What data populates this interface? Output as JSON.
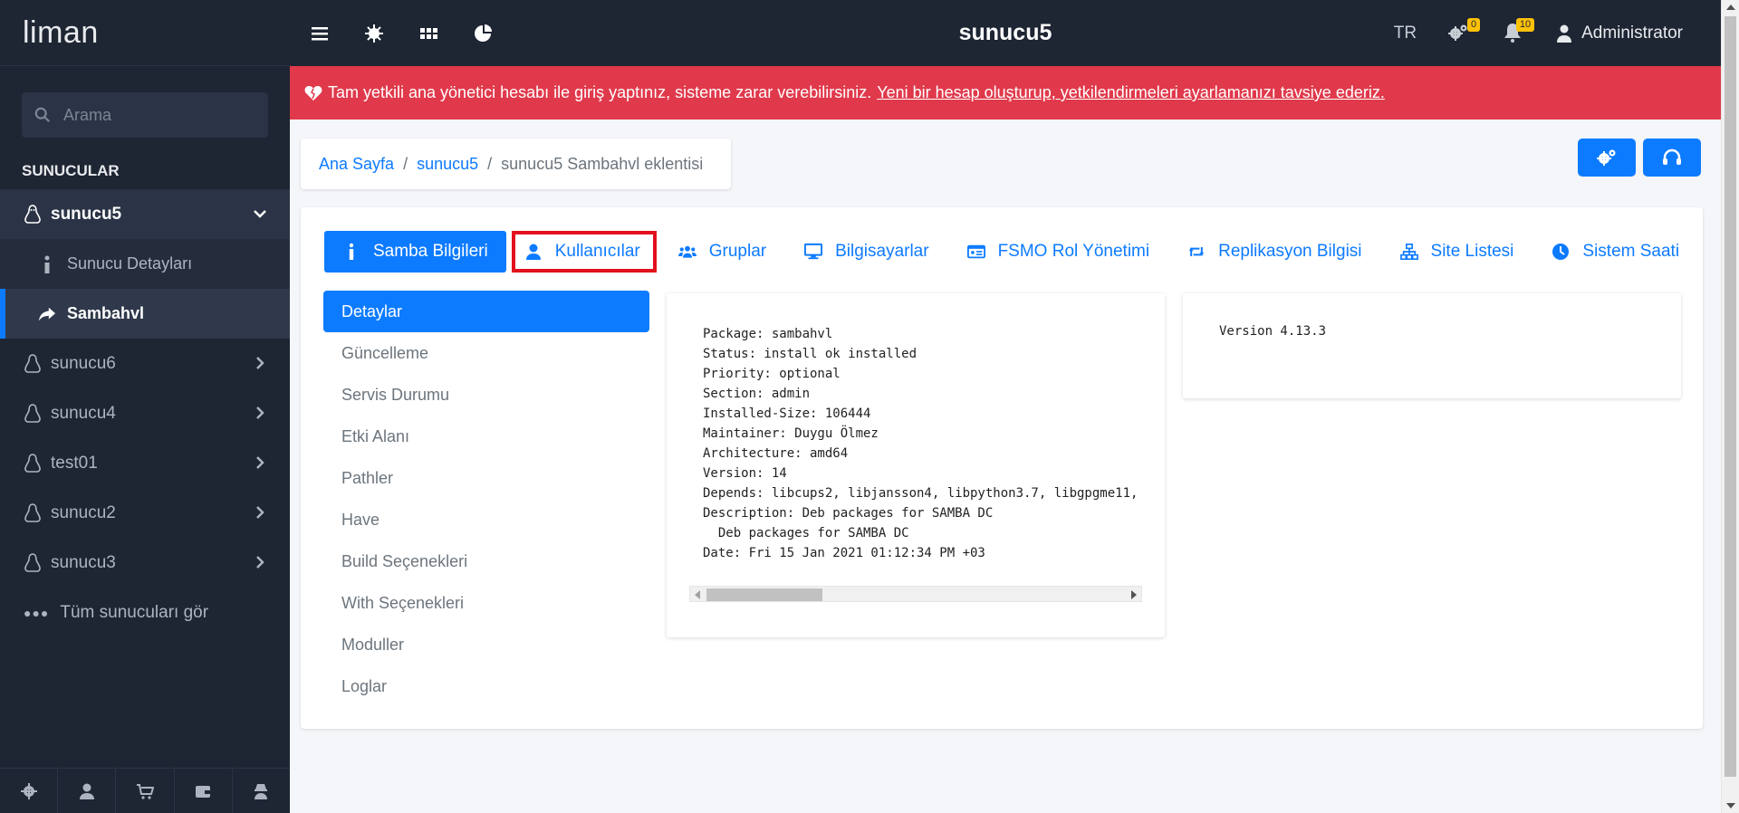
{
  "app": {
    "logo": "liman",
    "page_title": "sunucu5"
  },
  "sidebar": {
    "search_placeholder": "Arama",
    "section_title": "SUNUCULAR",
    "servers": [
      {
        "label": "sunucu5",
        "active": true,
        "subitems": [
          {
            "label": "Sunucu Detayları"
          },
          {
            "label": "Sambahvl",
            "current": true
          }
        ]
      },
      {
        "label": "sunucu6"
      },
      {
        "label": "sunucu4"
      },
      {
        "label": "test01"
      },
      {
        "label": "sunucu2"
      },
      {
        "label": "sunucu3"
      }
    ],
    "all_servers": "Tüm sunucuları gör",
    "footer_icons": [
      "settings-icon",
      "user-icon",
      "cart-icon",
      "wallet-icon",
      "spy-icon"
    ]
  },
  "topbar": {
    "lang": "TR",
    "settings_badge": "0",
    "notifications_badge": "10",
    "user": "Administrator"
  },
  "alert": {
    "text": "Tam yetkili ana yönetici hesabı ile giriş yaptınız, sisteme zarar verebilirsiniz.",
    "link": "Yeni bir hesap oluşturup, yetkilendirmeleri ayarlamanızı tavsiye ederiz."
  },
  "breadcrumb": {
    "home": "Ana Sayfa",
    "server": "sunucu5",
    "current": "sunucu5 Sambahvl eklentisi"
  },
  "tabs": [
    {
      "label": "Samba Bilgileri",
      "icon": "info-icon",
      "active": true
    },
    {
      "label": "Kullanıcılar",
      "icon": "user-icon",
      "highlight": true
    },
    {
      "label": "Gruplar",
      "icon": "users-icon"
    },
    {
      "label": "Bilgisayarlar",
      "icon": "desktop-icon"
    },
    {
      "label": "FSMO Rol Yönetimi",
      "icon": "id-card-icon"
    },
    {
      "label": "Replikasyon Bilgisi",
      "icon": "retweet-icon"
    },
    {
      "label": "Site Listesi",
      "icon": "sitemap-icon"
    },
    {
      "label": "Sistem Saati",
      "icon": "clock-icon"
    }
  ],
  "pills": [
    "Detaylar",
    "Güncelleme",
    "Servis Durumu",
    "Etki Alanı",
    "Pathler",
    "Have",
    "Build Seçenekleri",
    "With Seçenekleri",
    "Moduller",
    "Loglar"
  ],
  "package_info": "Package: sambahvl\nStatus: install ok installed\nPriority: optional\nSection: admin\nInstalled-Size: 106444\nMaintainer: Duygu Ölmez\nArchitecture: amd64\nVersion: 14\nDepends: libcups2, libjansson4, libpython3.7, libgpgme11,\nDescription: Deb packages for SAMBA DC\n  Deb packages for SAMBA DC\nDate: Fri 15 Jan 2021 01:12:34 PM +03",
  "version_info": "Version 4.13.3",
  "colors": {
    "primary": "#0d7bff",
    "sidebar": "#1e2533",
    "alert": "#e0394b",
    "highlight_box": "#e3101d",
    "badge": "#ffc107"
  }
}
